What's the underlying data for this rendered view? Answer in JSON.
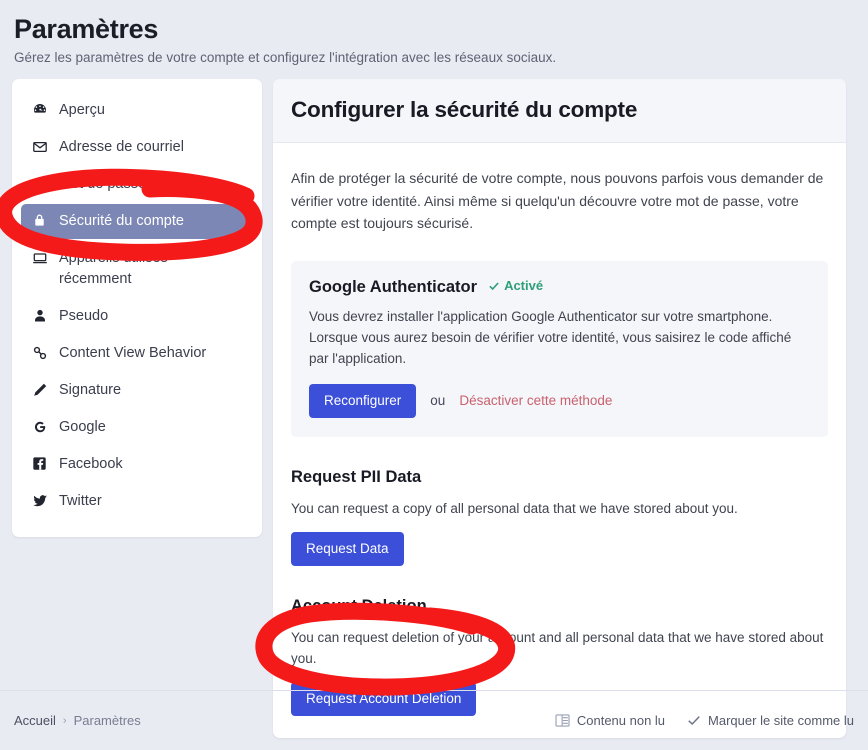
{
  "header": {
    "title": "Paramètres",
    "subtitle": "Gérez les paramètres de votre compte et configurez l'intégration avec les réseaux sociaux."
  },
  "sidebar": {
    "items": [
      {
        "label": "Aperçu",
        "icon": "dashboard-icon",
        "active": false
      },
      {
        "label": "Adresse de courriel",
        "icon": "envelope-icon",
        "active": false
      },
      {
        "label": "Mot de passe",
        "icon": "key-icon",
        "active": false
      },
      {
        "label": "Sécurité du compte",
        "icon": "lock-icon",
        "active": true
      },
      {
        "label": "Appareils utilisés récemment",
        "icon": "devices-icon",
        "active": false
      },
      {
        "label": "Pseudo",
        "icon": "user-icon",
        "active": false
      },
      {
        "label": "Content View Behavior",
        "icon": "link-icon",
        "active": false
      },
      {
        "label": "Signature",
        "icon": "pencil-icon",
        "active": false
      },
      {
        "label": "Google",
        "icon": "google-icon",
        "active": false
      },
      {
        "label": "Facebook",
        "icon": "facebook-icon",
        "active": false
      },
      {
        "label": "Twitter",
        "icon": "twitter-icon",
        "active": false
      }
    ]
  },
  "main": {
    "heading": "Configurer la sécurité du compte",
    "intro": "Afin de protéger la sécurité de votre compte, nous pouvons parfois vous demander de vérifier votre identité. Ainsi même si quelqu'un découvre votre mot de passe, votre compte est toujours sécurisé.",
    "authenticator": {
      "title": "Google Authenticator",
      "status_label": "Activé",
      "status_color": "#2f9e79",
      "description": "Vous devrez installer l'application Google Authenticator sur votre smartphone. Lorsque vous aurez besoin de vérifier votre identité, vous saisirez le code affiché par l'application.",
      "primary_button": "Reconfigurer",
      "separator_word": "ou",
      "danger_link": "Désactiver cette méthode",
      "danger_color": "#c9616e"
    },
    "pii": {
      "title": "Request PII Data",
      "description": "You can request a copy of all personal data that we have stored about you.",
      "button": "Request Data"
    },
    "deletion": {
      "title": "Account Deletion",
      "description": "You can request deletion of your account and all personal data that we have stored about you.",
      "button": "Request Account Deletion"
    }
  },
  "footer": {
    "breadcrumb_home": "Accueil",
    "breadcrumb_sep": "›",
    "breadcrumb_current": "Paramètres",
    "unread_label": "Contenu non lu",
    "mark_read_label": "Marquer le site comme lu"
  },
  "theme": {
    "primary_button": "#3b4fd8",
    "active_nav": "#7c87b5",
    "page_background": "#e9ebf3",
    "annotation_color": "#f51a1a"
  }
}
